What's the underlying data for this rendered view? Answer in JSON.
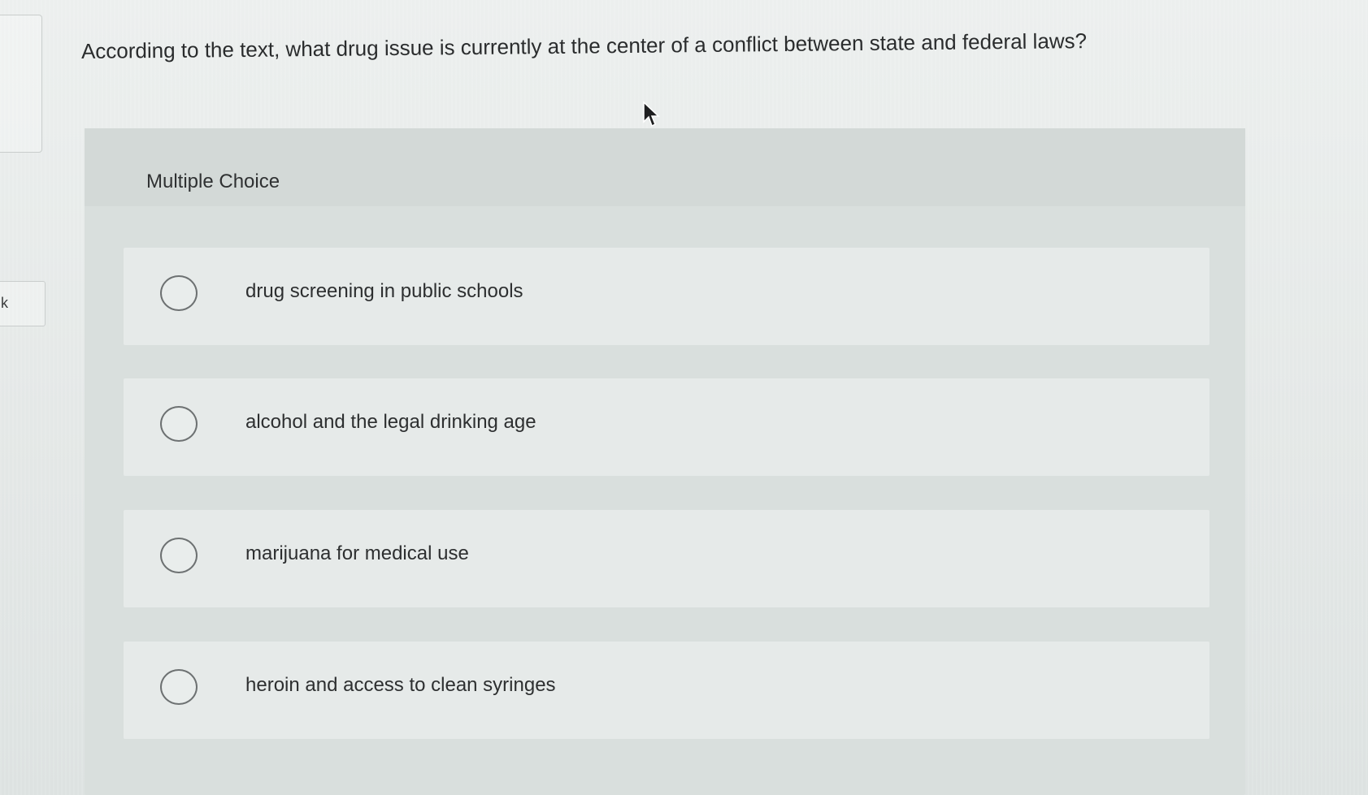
{
  "question": {
    "text": "According to the text, what drug issue is currently at the center of a conflict between state and federal laws?"
  },
  "side_tab": {
    "label": "k"
  },
  "multiple_choice": {
    "label": "Multiple Choice",
    "options": [
      {
        "label": "drug screening in public schools"
      },
      {
        "label": "alcohol and the legal drinking age"
      },
      {
        "label": "marijuana for medical use"
      },
      {
        "label": "heroin and access to clean syringes"
      }
    ]
  },
  "icons": {
    "cursor": "mouse-pointer-icon",
    "radio": "radio-unchecked-icon"
  }
}
